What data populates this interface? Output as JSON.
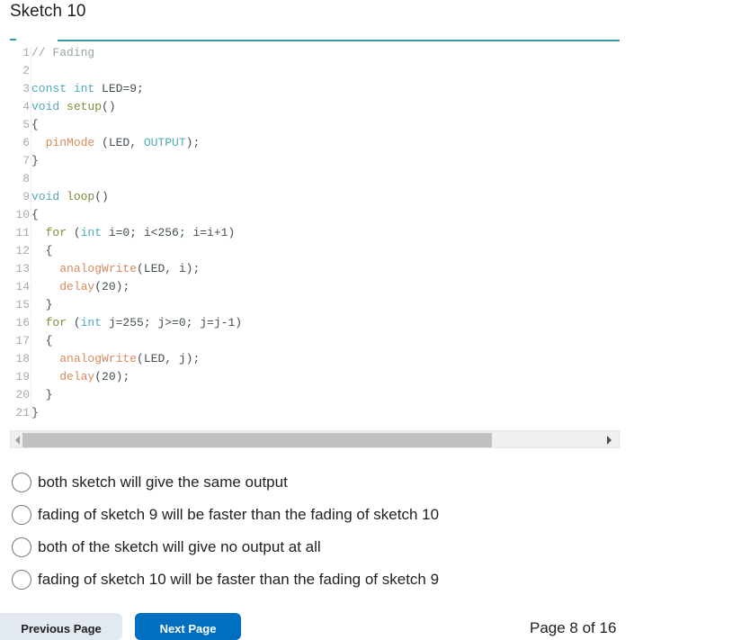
{
  "title": "Sketch 10",
  "code": {
    "lines": [
      {
        "n": "1",
        "tokens": [
          {
            "t": "// Fading",
            "c": "c-comment"
          }
        ]
      },
      {
        "n": "2",
        "tokens": []
      },
      {
        "n": "3",
        "tokens": [
          {
            "t": "const",
            "c": "c-kw"
          },
          {
            "t": " ",
            "c": "c-plain"
          },
          {
            "t": "int",
            "c": "c-kw"
          },
          {
            "t": " LED=9;",
            "c": "c-plain"
          }
        ]
      },
      {
        "n": "4",
        "tokens": [
          {
            "t": "void",
            "c": "c-kw"
          },
          {
            "t": " ",
            "c": "c-plain"
          },
          {
            "t": "setup",
            "c": "c-lifecycle"
          },
          {
            "t": "()",
            "c": "c-plain"
          }
        ]
      },
      {
        "n": "5",
        "tokens": [
          {
            "t": "{",
            "c": "c-plain"
          }
        ]
      },
      {
        "n": "6",
        "tokens": [
          {
            "t": "  ",
            "c": "c-plain"
          },
          {
            "t": "pinMode",
            "c": "c-fn"
          },
          {
            "t": " (LED, ",
            "c": "c-plain"
          },
          {
            "t": "OUTPUT",
            "c": "c-const"
          },
          {
            "t": ");",
            "c": "c-plain"
          }
        ]
      },
      {
        "n": "7",
        "tokens": [
          {
            "t": "}",
            "c": "c-plain"
          }
        ]
      },
      {
        "n": "8",
        "tokens": []
      },
      {
        "n": "9",
        "tokens": [
          {
            "t": "void",
            "c": "c-kw"
          },
          {
            "t": " ",
            "c": "c-plain"
          },
          {
            "t": "loop",
            "c": "c-lifecycle"
          },
          {
            "t": "()",
            "c": "c-plain"
          }
        ]
      },
      {
        "n": "10",
        "tokens": [
          {
            "t": "{",
            "c": "c-plain"
          }
        ]
      },
      {
        "n": "11",
        "tokens": [
          {
            "t": "  ",
            "c": "c-plain"
          },
          {
            "t": "for",
            "c": "c-lifecycle"
          },
          {
            "t": " (",
            "c": "c-plain"
          },
          {
            "t": "int",
            "c": "c-kw"
          },
          {
            "t": " i=0; i<256; i=i+1)",
            "c": "c-plain"
          }
        ]
      },
      {
        "n": "12",
        "tokens": [
          {
            "t": "  {",
            "c": "c-plain"
          }
        ]
      },
      {
        "n": "13",
        "tokens": [
          {
            "t": "    ",
            "c": "c-plain"
          },
          {
            "t": "analogWrite",
            "c": "c-fn"
          },
          {
            "t": "(LED, i);",
            "c": "c-plain"
          }
        ]
      },
      {
        "n": "14",
        "tokens": [
          {
            "t": "    ",
            "c": "c-plain"
          },
          {
            "t": "delay",
            "c": "c-fn"
          },
          {
            "t": "(20);",
            "c": "c-plain"
          }
        ]
      },
      {
        "n": "15",
        "tokens": [
          {
            "t": "  }",
            "c": "c-plain"
          }
        ]
      },
      {
        "n": "16",
        "tokens": [
          {
            "t": "  ",
            "c": "c-plain"
          },
          {
            "t": "for",
            "c": "c-lifecycle"
          },
          {
            "t": " (",
            "c": "c-plain"
          },
          {
            "t": "int",
            "c": "c-kw"
          },
          {
            "t": " j=255; j>=0; j=j-1)",
            "c": "c-plain"
          }
        ]
      },
      {
        "n": "17",
        "tokens": [
          {
            "t": "  {",
            "c": "c-plain"
          }
        ]
      },
      {
        "n": "18",
        "tokens": [
          {
            "t": "    ",
            "c": "c-plain"
          },
          {
            "t": "analogWrite",
            "c": "c-fn"
          },
          {
            "t": "(LED, j);",
            "c": "c-plain"
          }
        ]
      },
      {
        "n": "19",
        "tokens": [
          {
            "t": "    ",
            "c": "c-plain"
          },
          {
            "t": "delay",
            "c": "c-fn"
          },
          {
            "t": "(20);",
            "c": "c-plain"
          }
        ]
      },
      {
        "n": "20",
        "tokens": [
          {
            "t": "  }",
            "c": "c-plain"
          }
        ]
      },
      {
        "n": "21",
        "tokens": [
          {
            "t": "}",
            "c": "c-plain"
          }
        ]
      }
    ]
  },
  "icons": {
    "scroll_left": "triangle-left-icon",
    "scroll_right": "triangle-right-icon",
    "radio": "radio-unchecked-icon"
  },
  "options": [
    {
      "label": "both sketch will give the same output",
      "selected": false
    },
    {
      "label": "fading of sketch 9 will be faster than the fading of sketch 10",
      "selected": false
    },
    {
      "label": "both of the sketch will give no output at all",
      "selected": false
    },
    {
      "label": "fading of sketch 10 will be faster than the fading of sketch 9",
      "selected": false
    }
  ],
  "nav": {
    "previous_label": "Previous Page",
    "next_label": "Next Page",
    "page_indicator": "Page 8 of 16"
  },
  "colors": {
    "accent": "#006fbf",
    "code_rule": "#3a9aa8"
  }
}
